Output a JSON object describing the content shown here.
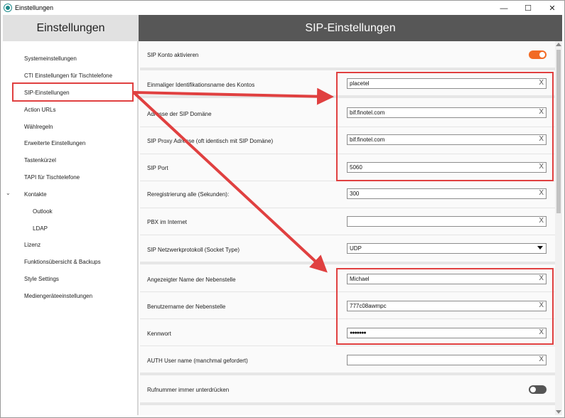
{
  "window": {
    "title": "Einstellungen"
  },
  "sidebar": {
    "header": "Einstellungen",
    "items": [
      {
        "label": "Systemeinstellungen"
      },
      {
        "label": "CTI Einstellungen für Tischtelefone"
      },
      {
        "label": "SIP-Einstellungen"
      },
      {
        "label": "Action URLs"
      },
      {
        "label": "Wählregeln"
      },
      {
        "label": "Erweiterte Einstellungen"
      },
      {
        "label": "Tastenkürzel"
      },
      {
        "label": "TAPI für Tischtelefone"
      },
      {
        "label": "Kontakte"
      },
      {
        "label": "Outlook"
      },
      {
        "label": "LDAP"
      },
      {
        "label": "Lizenz"
      },
      {
        "label": "Funktionsübersicht & Backups"
      },
      {
        "label": "Style Settings"
      },
      {
        "label": "Mediengeräteeinstellungen"
      }
    ]
  },
  "main": {
    "header": "SIP-Einstellungen",
    "sip_account_active": {
      "label": "SIP Konto aktivieren",
      "state": "on"
    },
    "fields": {
      "account_name": {
        "label": "Einmaliger Identifikationsname des Kontos",
        "value": "placetel"
      },
      "sip_domain": {
        "label": "Adresse der SIP Domäne",
        "value": "bif.finotel.com"
      },
      "sip_proxy": {
        "label": "SIP Proxy Adresse (oft identisch mit SIP Domäne)",
        "value": "bif.finotel.com"
      },
      "sip_port": {
        "label": "SIP Port",
        "value": "5060"
      },
      "reregistration": {
        "label": "Reregistrierung alle (Sekunden):",
        "value": "300"
      },
      "pbx_internet": {
        "label": "PBX im Internet",
        "value": ""
      },
      "socket_type": {
        "label": "SIP Netzwerkprotokoll (Socket Type)",
        "value": "UDP"
      },
      "display_name": {
        "label": "Angezeigter Name der Nebenstelle",
        "value": "Michael"
      },
      "username": {
        "label": "Benutzername der Nebenstelle",
        "value": "777c08awmpc"
      },
      "password": {
        "label": "Kennwort",
        "value": "●●●●●●●"
      },
      "auth_user": {
        "label": "AUTH User name (manchmal gefordert)",
        "value": ""
      }
    },
    "suppress_number": {
      "label": "Rufnummer immer unterdrücken",
      "state": "off"
    },
    "clear_glyph": "X"
  },
  "icons": {
    "window_minimize": "—",
    "window_maximize": "☐",
    "window_close": "✕",
    "chevron": "⌄"
  },
  "colors": {
    "accent": "#f26a24",
    "header_dark": "#575757",
    "annotation": "#e04040"
  }
}
